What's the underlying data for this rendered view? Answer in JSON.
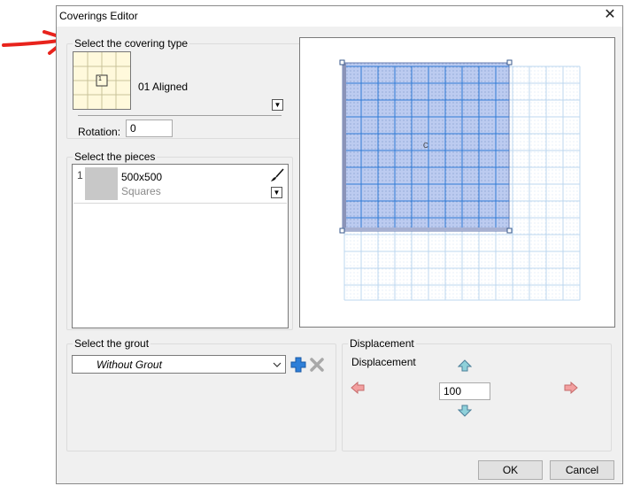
{
  "dialog": {
    "title": "Coverings Editor"
  },
  "covering_type": {
    "legend": "Select the covering type",
    "selected_name": "01 Aligned",
    "thumb_number": "1",
    "rotation_label": "Rotation:",
    "rotation_value": "0"
  },
  "pieces": {
    "legend": "Select the pieces",
    "items": [
      {
        "index": "1",
        "size": "500x500",
        "type": "Squares"
      }
    ]
  },
  "grout": {
    "legend": "Select the grout",
    "selected": "Without Grout"
  },
  "displacement": {
    "legend": "Displacement",
    "label": "Displacement",
    "value": "100"
  },
  "preview": {
    "center_marker": "C"
  },
  "buttons": {
    "ok": "OK",
    "cancel": "Cancel"
  },
  "colors": {
    "annotation_arrow": "#e8231c",
    "tile_fill": "#b8c8f0",
    "grid_line": "#2f7bd6"
  }
}
